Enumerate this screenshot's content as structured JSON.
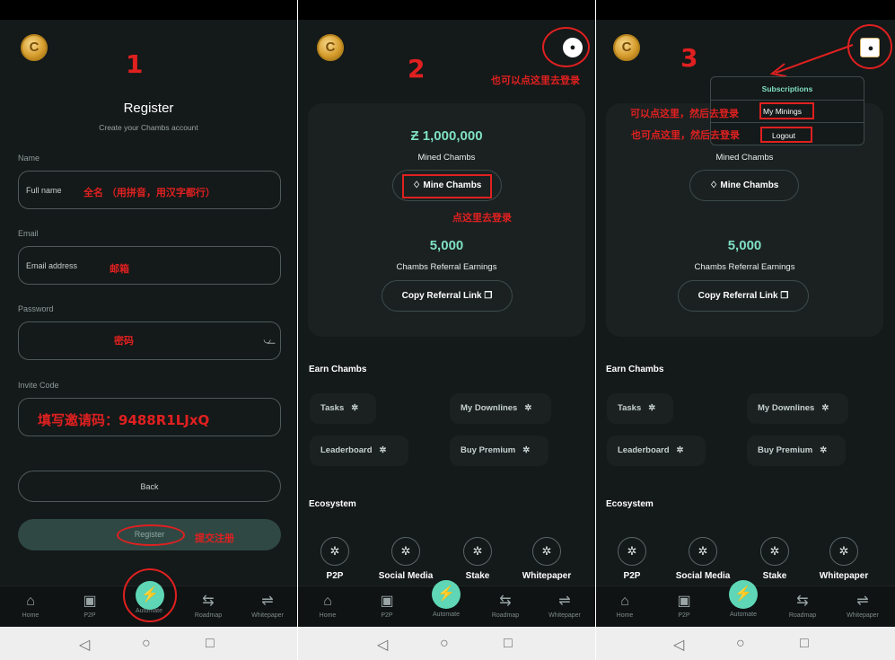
{
  "steps": [
    "1",
    "2",
    "3"
  ],
  "coin_glyph": "C",
  "register": {
    "title": "Register",
    "subtitle": "Create your Chambs account",
    "name_label": "Name",
    "name_placeholder": "Full name",
    "name_note": "全名 （用拼音，用汉字都行）",
    "email_label": "Email",
    "email_placeholder": "Email address",
    "email_note": "邮箱",
    "password_label": "Password",
    "password_note": "密码",
    "invite_label": "Invite Code",
    "invite_note": "填写邀请码：9488R1LJxQ",
    "back_label": "Back",
    "register_label": "Register",
    "register_note": "提交注册"
  },
  "dashboard": {
    "mined_value": "Ƶ 1,000,000",
    "mined_label": "Mined Chambs",
    "mine_button": "Mine Chambs",
    "referral_value": "5,000",
    "referral_label": "Chambs Referral Earnings",
    "copy_button": "Copy Referral Link",
    "earn_title": "Earn Chambs",
    "earn_items": [
      "Tasks",
      "My Downlines",
      "Leaderboard",
      "Buy Premium"
    ],
    "ecosystem_title": "Ecosystem",
    "ecosystem_items": [
      "P2P",
      "Social Media",
      "Stake",
      "Whitepaper"
    ]
  },
  "annotations": {
    "avatar_note": "也可以点这里去登录",
    "mine_note": "点这里去登录",
    "my_minings_note": "可以点这里，然后去登录",
    "logout_note": "也可点这里，然后去登录"
  },
  "dropdown": {
    "title": "Subscriptions",
    "my_minings": "My Minings",
    "logout": "Logout"
  },
  "nav": {
    "items": [
      "Home",
      "P2P",
      "Automate",
      "Roadmap",
      "Whitepaper"
    ]
  },
  "colors": {
    "background": "#141919",
    "accent": "#5fd6b5",
    "annotation_red": "#e02020"
  }
}
